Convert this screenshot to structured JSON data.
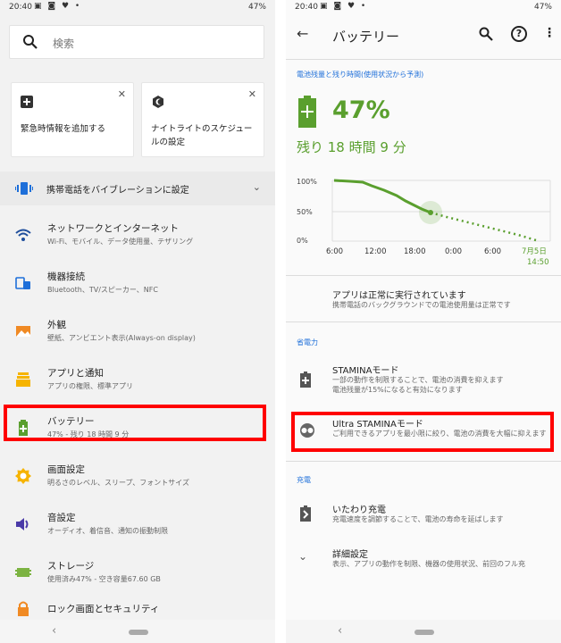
{
  "status": {
    "time": "20:40",
    "battery": "47%"
  },
  "left": {
    "search_placeholder": "検索",
    "cards": [
      {
        "text": "緊急時情報を追加する"
      },
      {
        "text": "ナイトライトのスケジュールの設定"
      }
    ],
    "close_glyph": "✕",
    "vibrate_row": "携帯電話をバイブレーションに設定",
    "items": [
      {
        "title": "ネットワークとインターネット",
        "sub": "Wi-Fi、モバイル、データ使用量、テザリング",
        "icon": "wifi-icon"
      },
      {
        "title": "機器接続",
        "sub": "Bluetooth、TV/スピーカー、NFC",
        "icon": "devices-icon"
      },
      {
        "title": "外観",
        "sub": "壁紙、アンビエント表示(Always-on display)",
        "icon": "wallpaper-icon"
      },
      {
        "title": "アプリと通知",
        "sub": "アプリの権限、標準アプリ",
        "icon": "apps-icon"
      },
      {
        "title": "バッテリー",
        "sub": "47% - 残り 18 時間 9 分",
        "icon": "battery-icon"
      },
      {
        "title": "画面設定",
        "sub": "明るさのレベル、スリープ、フォントサイズ",
        "icon": "brightness-icon"
      },
      {
        "title": "音設定",
        "sub": "オーディオ、着信音、通知の振動制限",
        "icon": "volume-icon"
      },
      {
        "title": "ストレージ",
        "sub": "使用済み47% - 空き容量67.60 GB",
        "icon": "storage-icon"
      },
      {
        "title": "ロック画面とセキュリティ",
        "sub": "",
        "icon": "lock-icon"
      }
    ]
  },
  "right": {
    "title": "バッテリー",
    "estimate_header": "電池残量と残り時間(使用状況から予測)",
    "percent": "47%",
    "remaining": "残り 18 時間  9 分",
    "chart_ylabels": [
      "100%",
      "50%",
      "0%"
    ],
    "chart_xlabels": [
      "6:00",
      "12:00",
      "18:00",
      "0:00",
      "6:00"
    ],
    "chart_end_date": "7月5日",
    "chart_end_time": "14:50",
    "status_title": "アプリは正常に実行されています",
    "status_sub": "携帯電話のバックグラウンドでの電池使用量は正常です",
    "power_header": "省電力",
    "stamina_title": "STAMINAモード",
    "stamina_sub": "一部の動作を制限することで、電池の消費を抑えます\n電池残量が15%になると有効になります",
    "ultra_title": "Ultra STAMINAモード",
    "ultra_sub": "ご利用できるアプリを最小限に絞り、電池の消費を大幅に抑えます",
    "charge_header": "充電",
    "care_title": "いたわり充電",
    "care_sub": "充電速度を調節することで、電池の寿命を延ばします",
    "detail_title": "詳細設定",
    "detail_sub": "表示、アプリの動作を制限、機器の使用状況、前回のフル充"
  },
  "colors": {
    "accent_green": "#5a9f2e",
    "link_blue": "#1e6fd9",
    "highlight_red": "#ff0000"
  }
}
